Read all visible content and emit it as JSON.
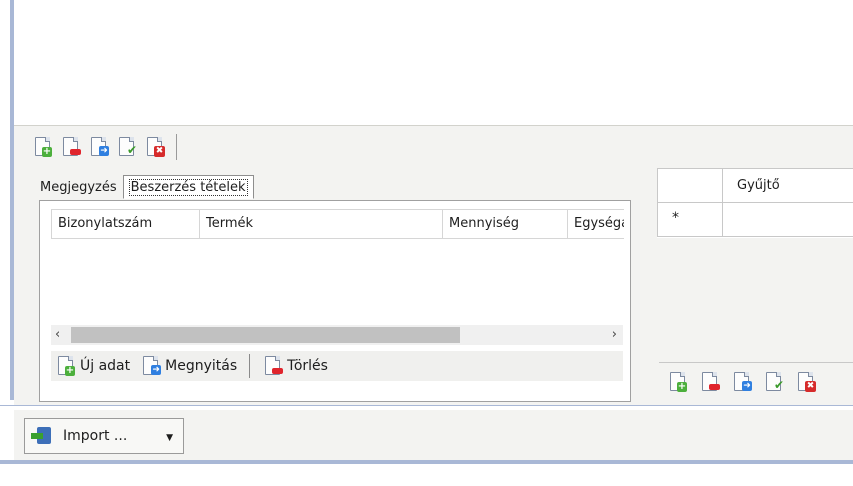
{
  "window_toolbar": {
    "icons": [
      "add-doc-icon",
      "delete-doc-icon",
      "open-doc-icon",
      "check-doc-icon",
      "cancel-doc-icon"
    ]
  },
  "tabs": [
    {
      "label": "Megjegyzés",
      "active": false
    },
    {
      "label": "Beszerzés tételek",
      "active": true
    }
  ],
  "items_grid": {
    "columns": [
      "Bizonylatszám",
      "Termék",
      "Mennyiség",
      "Egységá"
    ]
  },
  "items_toolbar": {
    "new_label": "Új adat",
    "open_label": "Megnyitás",
    "delete_label": "Törlés"
  },
  "right_grid": {
    "column": "Gyűjtő",
    "new_row_marker": "*"
  },
  "bottom": {
    "import_label": "Import ..."
  },
  "colors": {
    "frame_accent": "#a9b8d6",
    "panel_bg": "#f3f3f1",
    "add_green": "#4caf3c",
    "delete_red": "#e0242c",
    "open_blue": "#2f7fe0"
  }
}
